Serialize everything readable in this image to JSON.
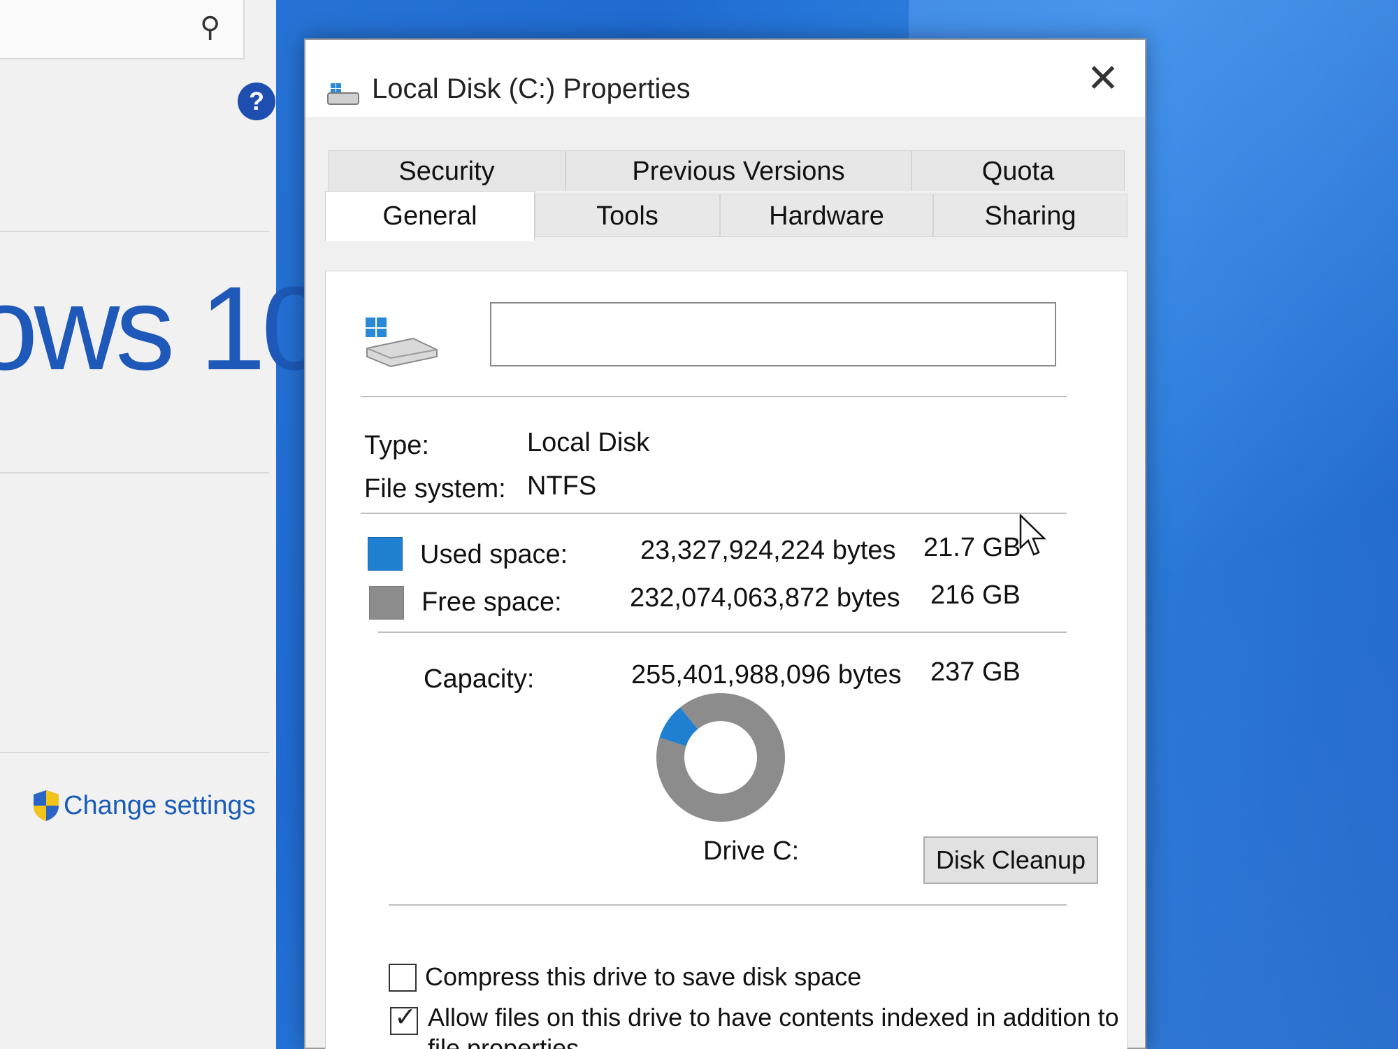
{
  "background_window": {
    "title_fragment": "ows 10",
    "change_settings": "Change settings",
    "icons": {
      "search": "search-icon",
      "help": "help-icon",
      "shield": "shield-icon"
    }
  },
  "dialog": {
    "title": "Local Disk (C:) Properties",
    "close_glyph": "✕",
    "tabs_back": [
      {
        "label": "Security"
      },
      {
        "label": "Previous Versions"
      },
      {
        "label": "Quota"
      }
    ],
    "tabs_front": [
      {
        "label": "General",
        "selected": true
      },
      {
        "label": "Tools"
      },
      {
        "label": "Hardware"
      },
      {
        "label": "Sharing"
      }
    ],
    "general": {
      "drive_label_value": "",
      "type_label": "Type:",
      "type_value": "Local Disk",
      "filesystem_label": "File system:",
      "filesystem_value": "NTFS",
      "used_label": "Used space:",
      "used_bytes": "23,327,924,224 bytes",
      "used_size": "21.7 GB",
      "free_label": "Free space:",
      "free_bytes": "232,074,063,872 bytes",
      "free_size": "216 GB",
      "capacity_label": "Capacity:",
      "capacity_bytes": "255,401,988,096 bytes",
      "capacity_size": "237 GB",
      "drive_caption": "Drive C:",
      "disk_cleanup_label": "Disk Cleanup",
      "compress_label": "Compress this drive to save disk space",
      "compress_checked": false,
      "index_label_line1": "Allow files on this drive to have contents indexed in addition to",
      "index_label_line2": "file properties",
      "index_checked": true
    },
    "colors": {
      "used": "#1f7fd0",
      "free": "#8c8c8c"
    }
  },
  "chart_data": {
    "type": "pie",
    "style": "donut",
    "slices": [
      {
        "name": "Used space",
        "value": 23327924224,
        "color": "#1f7fd0"
      },
      {
        "name": "Free space",
        "value": 232074063872,
        "color": "#8c8c8c"
      }
    ],
    "title": "Drive C:"
  }
}
